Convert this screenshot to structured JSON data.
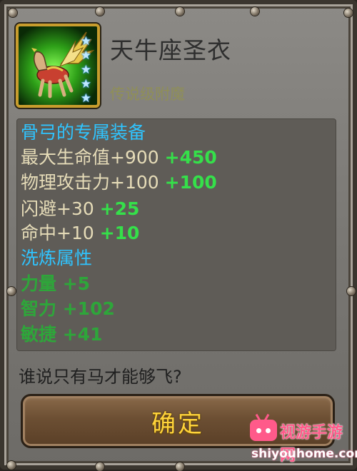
{
  "item": {
    "name": "天牛座圣衣",
    "grade": "传说级附魔",
    "stars": 5,
    "icon": "winged-pegasus-icon"
  },
  "stats": {
    "exclusive_header": "骨弓的专属装备",
    "rows": [
      {
        "label": "最大生命值+900",
        "bonus": "+450"
      },
      {
        "label": "物理攻击力+100",
        "bonus": "+100"
      },
      {
        "label": "闪避+30",
        "bonus": "+25"
      },
      {
        "label": "命中+10",
        "bonus": "+10"
      }
    ],
    "refine_header": "洗炼属性",
    "refine_rows": [
      {
        "label": "力量",
        "value": "+5"
      },
      {
        "label": "智力",
        "value": "+102"
      },
      {
        "label": "敏捷",
        "value": "+41"
      }
    ]
  },
  "description": "谁说只有马才能够飞?",
  "confirm_label": "确定",
  "watermark": {
    "cn": "视游手游网",
    "en": "shiyouhome.com"
  },
  "colors": {
    "header": "#2fc4ff",
    "stat_text": "#e6dcb8",
    "bonus": "#35e04a",
    "refine": "#2ea63a",
    "confirm_text": "#ffd43a"
  }
}
